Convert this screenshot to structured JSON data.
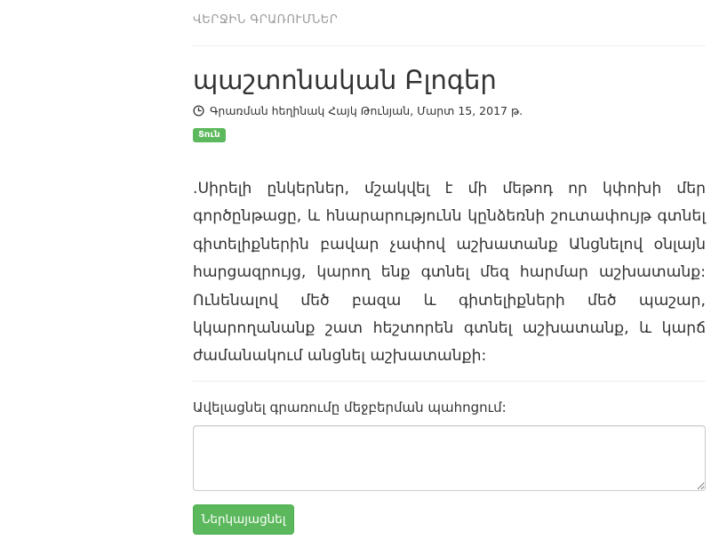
{
  "section": {
    "title": "ՎԵՐՋԻՆ ԳՐԱՌՈՒՄՆԵՐ"
  },
  "post": {
    "title": "պաշտոնական Բլոգեր",
    "meta": "Գրառման հեղինակ Հայկ Թունյան, Մարտ 15, 2017 թ.",
    "meta_icon": "clock-icon",
    "badge": "Տուն",
    "body": ".Սիրելի ընկերներ, մշակվել է մի մեթոդ որ կփոխի մեր գործընթացը, և հնարարությունն կընձեռնի շուտափույթ գտնել գիտելիքներին բավար չափով աշխատանք Անցնելով օնլայն հարցազրույց, կարող ենք գտնել մեզ հարմար աշխատանք: Ունենալով մեծ բազա և գիտելիքների մեծ պաշար, կկարողանանք շատ հեշտորեն գտնել աշխատանք, և կարճ ժամանակում անցնել աշխատանքի:"
  },
  "comment": {
    "label": "Ավելացնել գրառումը մեջբերման պահոցում:",
    "value": "",
    "submit_label": "Ներկայացնել"
  },
  "colors": {
    "accent_green": "#5cb85c",
    "muted_text": "#999999",
    "divider": "#eeeeee"
  }
}
